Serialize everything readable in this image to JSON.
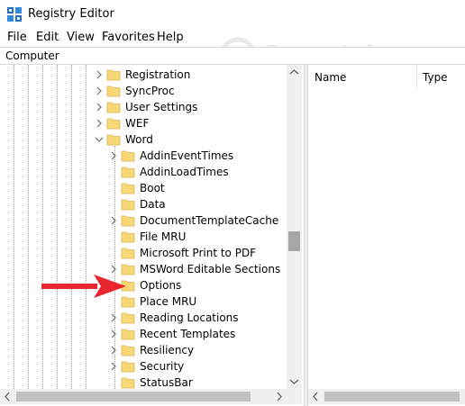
{
  "window": {
    "title": "Registry Editor"
  },
  "menu": [
    "File",
    "Edit",
    "View",
    "Favorites",
    "Help"
  ],
  "address": "Computer",
  "tree": [
    {
      "label": "Registration",
      "expander": "collapsed"
    },
    {
      "label": "SyncProc",
      "expander": "collapsed"
    },
    {
      "label": "User Settings",
      "expander": "collapsed"
    },
    {
      "label": "WEF",
      "expander": "collapsed"
    },
    {
      "label": "Word",
      "expander": "expanded"
    },
    {
      "label": "AddinEventTimes",
      "expander": "collapsed"
    },
    {
      "label": "AddinLoadTimes",
      "expander": "none"
    },
    {
      "label": "Boot",
      "expander": "none"
    },
    {
      "label": "Data",
      "expander": "none"
    },
    {
      "label": "DocumentTemplateCache",
      "expander": "collapsed"
    },
    {
      "label": "File MRU",
      "expander": "none"
    },
    {
      "label": "Microsoft Print to PDF",
      "expander": "none"
    },
    {
      "label": "MSWord Editable Sections",
      "expander": "collapsed"
    },
    {
      "label": "Options",
      "expander": "collapsed"
    },
    {
      "label": "Place MRU",
      "expander": "none"
    },
    {
      "label": "Reading Locations",
      "expander": "collapsed"
    },
    {
      "label": "Recent Templates",
      "expander": "collapsed"
    },
    {
      "label": "Resiliency",
      "expander": "collapsed"
    },
    {
      "label": "Security",
      "expander": "collapsed"
    },
    {
      "label": "StatusBar",
      "expander": "none"
    }
  ],
  "list": {
    "columns": [
      "Name",
      "Type"
    ]
  },
  "watermark": "Quantrimang",
  "colors": {
    "folder": "#f8d775",
    "folder_edge": "#dcb454",
    "arrow": "#e8262b",
    "icon_blue": "#1e6fc8"
  }
}
